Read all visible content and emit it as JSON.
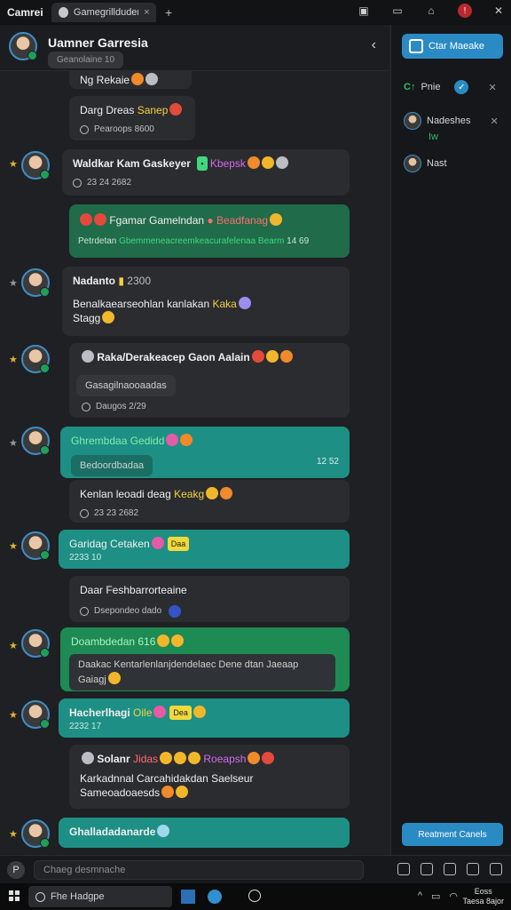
{
  "window": {
    "app_title": "Camrei",
    "tab_label": "Gamegrillduderx",
    "new_tab": "+"
  },
  "chat_header": {
    "name": "Uamner Garresia",
    "subtitle": "Geanolaine 10"
  },
  "right_panel": {
    "top_button": "Ctar Maeake",
    "items": [
      {
        "label": "Pnie",
        "prefix": "C↑"
      },
      {
        "label": "Nadeshes",
        "sub": "Iw"
      },
      {
        "label": "Nast"
      }
    ],
    "bottom_button": "Reatment Canels"
  },
  "messages": {
    "m1": {
      "text": "Ng Rekaie",
      "sub": "Darg Dreas",
      "sub_hl": "Sanep",
      "sub_meta": "Pearoops 8600"
    },
    "m2": {
      "text": "Waldkar Kam Gaskeyer",
      "hl": "Kbepsk",
      "meta": "23 24 2682"
    },
    "m3": {
      "text": "Fgamar Gamelndan",
      "hl": "Beadfanag",
      "sub": "Petrdetan",
      "sub_hl": "Gbemmeneacreemkeacurafelenaa Bearm",
      "sub_time": "14 69"
    },
    "m4": {
      "name": "Nadanto",
      "time": "2300",
      "text": "Benalkaearseohlan kanlakan",
      "hl": "Kaka",
      "text2": "Stagg"
    },
    "m5": {
      "text": "Raka/Derakeacep Gaon Aalain",
      "sub1": "Gasagilnaooaadas",
      "meta": "Daugos 2/29"
    },
    "m6": {
      "text": "Ghrembdaa Gedidd",
      "sub": "Bedoordbadaa",
      "time": "12 52",
      "text2": "Kenlan leoadi deag",
      "hl": "Keakg",
      "meta": "23 23 2682"
    },
    "m7": {
      "text": "Garidag Cetaken",
      "tag": "Daa",
      "sub": "2233 10"
    },
    "m8": {
      "text": "Daar Feshbarrorteaine",
      "meta": "Dsepondeo dado"
    },
    "m9": {
      "text": "Doambdedan 616",
      "sub": "Daakac Kentarlenlanjdendelaec Dene dtan Jaeaap",
      "sub2": "Gaiagj"
    },
    "m10": {
      "text": "Hacherlhagi",
      "hl": "Oile",
      "tag": "Dea",
      "sub": "2232 17"
    },
    "m11": {
      "title": "Solanr",
      "title2": "Jidas",
      "hl": "Roeapsh",
      "text": "Karkadnnal Carcahidakdan Saelseur",
      "text2": "Sameoadoaesds"
    },
    "m12": {
      "text": "Ghalladadanarde"
    }
  },
  "input": {
    "placeholder": "Chaeg desmnache",
    "attach": "P"
  },
  "taskbar": {
    "search": "Fhe Hadgpe",
    "time": "Eoss",
    "date": "Taesa 8ajor"
  },
  "colors": {
    "accent": "#2a8bc4",
    "dark_bubble": "#2b2c30",
    "green_bubble": "#1f6b4a",
    "teal_bubble": "#1e8f84"
  }
}
